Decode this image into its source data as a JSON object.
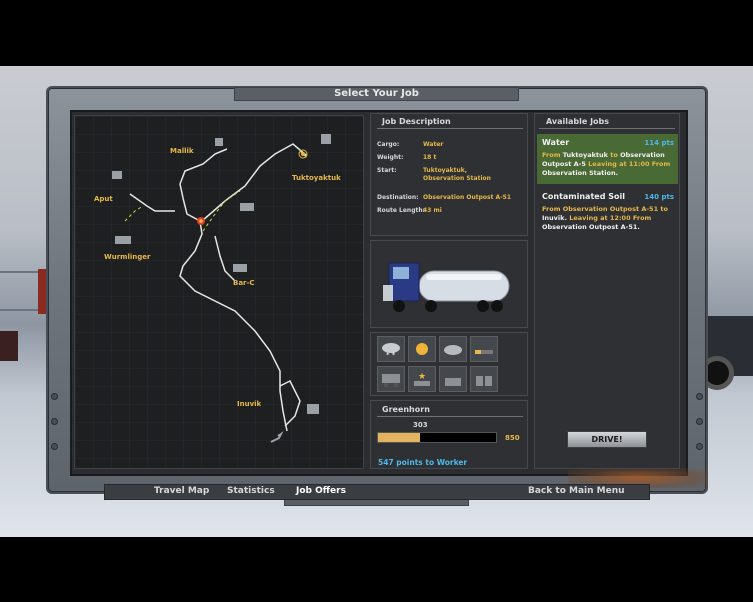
{
  "window_title": "Select Your Job",
  "map": {
    "towns": [
      {
        "name": "Mallik"
      },
      {
        "name": "Aput"
      },
      {
        "name": "Tuktoyaktuk"
      },
      {
        "name": "Wurmlinger"
      },
      {
        "name": "Bar-C"
      },
      {
        "name": "Inuvik"
      }
    ]
  },
  "job_description": {
    "header": "Job Description",
    "rows": [
      {
        "key": "Cargo:",
        "value": "Water"
      },
      {
        "key": "Weight:",
        "value": "18 t"
      },
      {
        "key": "Start:",
        "value": "Tuktoyaktuk, Observation Station"
      },
      {
        "key": "Destination:",
        "value": "Observation Outpost A-51"
      },
      {
        "key": "Route Length:",
        "value": "43 mi"
      }
    ]
  },
  "rank": {
    "title": "Greenhorn",
    "current_points": "303",
    "max_points": "850",
    "progress": 0.356,
    "next_rank_text": "547 points to Worker"
  },
  "available_jobs": {
    "header": "Available Jobs",
    "items": [
      {
        "title": "Water",
        "points": "114 pts",
        "from_word": "From",
        "origin": "Tuktoyaktuk",
        "to_word": "to",
        "destination": "Observation Outpost A-5",
        "leaving": "Leaving at 11:00 From",
        "start": "Observation Station."
      },
      {
        "title": "Contaminated Soil",
        "points": "140 pts",
        "from_word": "From",
        "origin": "Observation Outpost A-51",
        "to_word": "to",
        "destination": "Inuvik.",
        "leaving": "Leaving at 12:00 From",
        "start": "Observation Outpost A-51."
      }
    ]
  },
  "drive_label": "DRIVE!",
  "nav": {
    "travel_map": "Travel Map",
    "statistics": "Statistics",
    "job_offers": "Job Offers",
    "back": "Back to Main Menu"
  },
  "colors": {
    "accent_gold": "#e6b84a",
    "points_blue": "#4db8e8",
    "selected_green": "#4a6a35"
  }
}
